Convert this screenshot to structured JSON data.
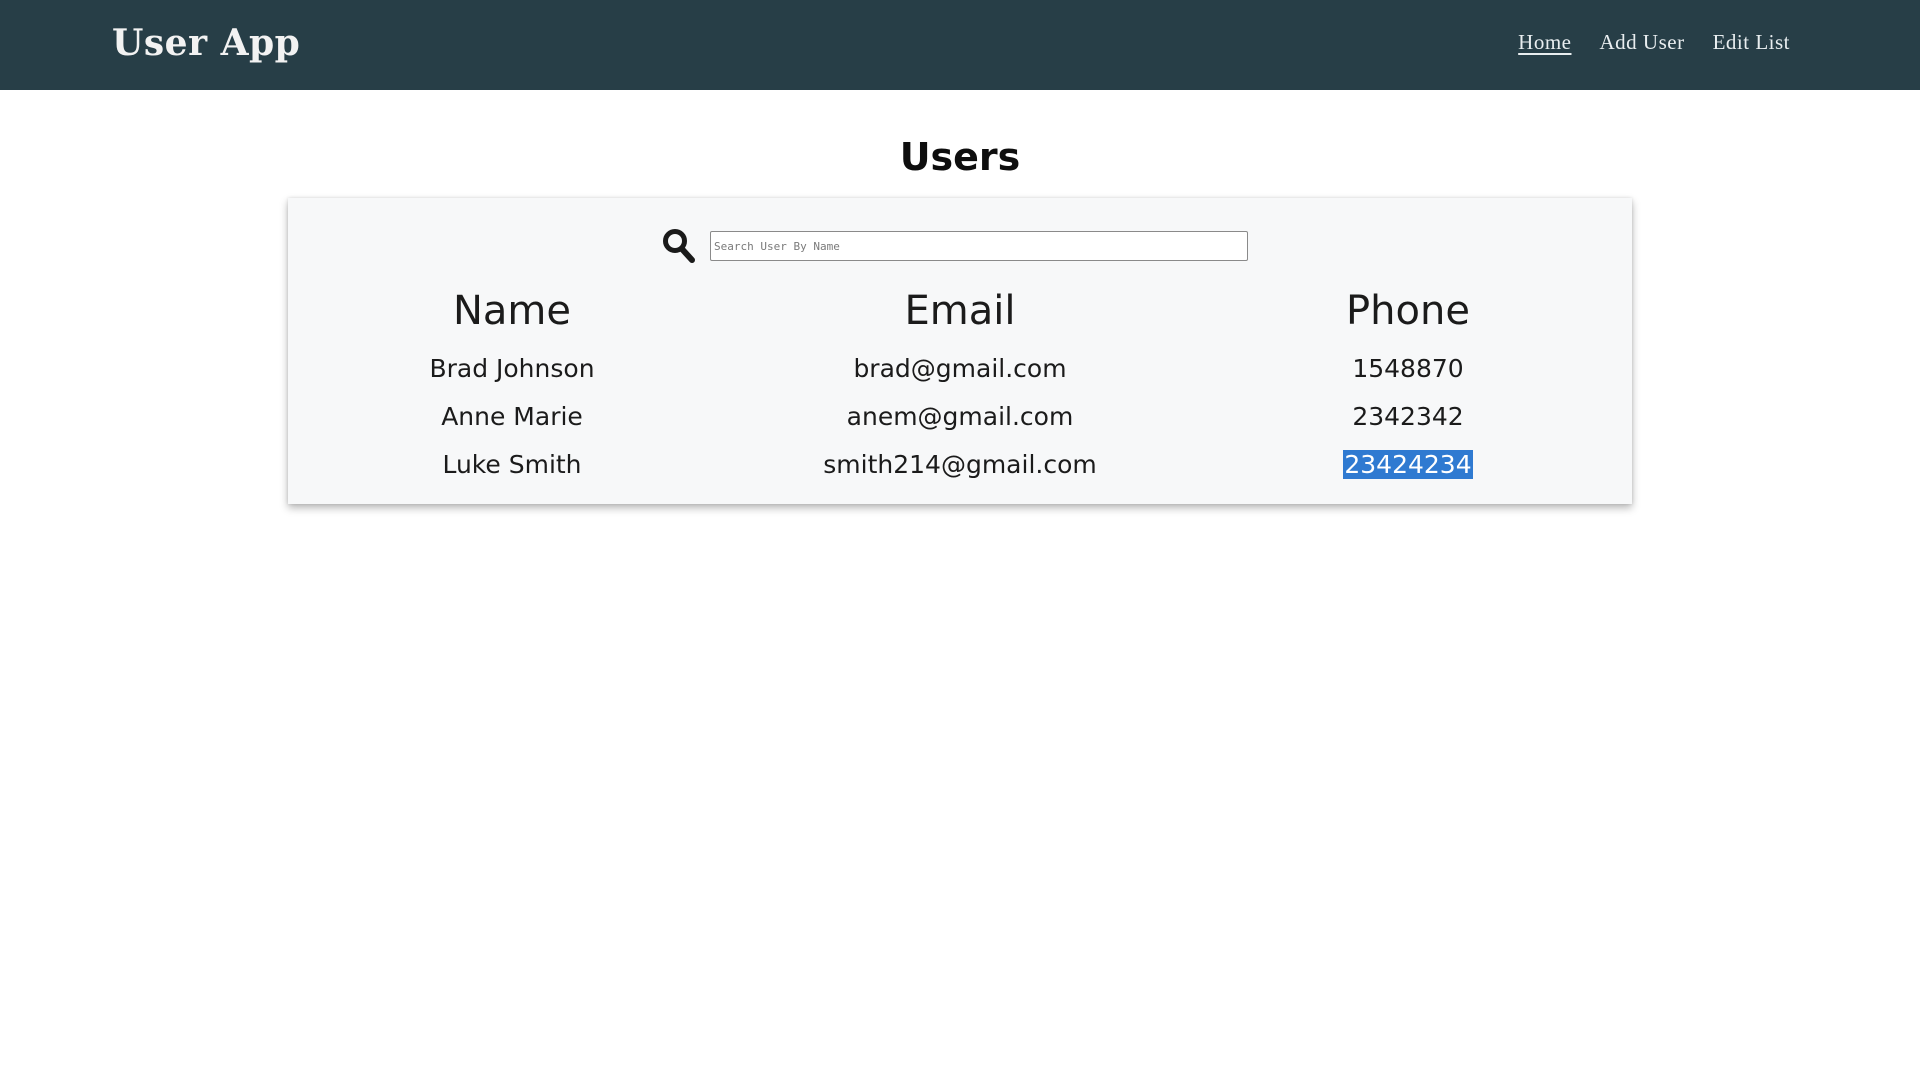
{
  "app": {
    "brand": "User App"
  },
  "nav": {
    "items": [
      {
        "label": "Home",
        "active": true
      },
      {
        "label": "Add User",
        "active": false
      },
      {
        "label": "Edit List",
        "active": false
      }
    ]
  },
  "page": {
    "title": "Users"
  },
  "search": {
    "icon": "search-icon",
    "placeholder": "Search User By Name",
    "value": ""
  },
  "table": {
    "headers": [
      "Name",
      "Email",
      "Phone"
    ],
    "rows": [
      {
        "name": "Brad Johnson",
        "email": "brad@gmail.com",
        "phone": "1548870"
      },
      {
        "name": "Anne Marie",
        "email": "anem@gmail.com",
        "phone": "2342342"
      },
      {
        "name": "Luke Smith",
        "email": "smith214@gmail.com",
        "phone": "23424234"
      }
    ],
    "selected_text": "23424234"
  },
  "colors": {
    "navbar": "#273e47",
    "card": "#f7f8f9",
    "selection": "#2f7ad1"
  }
}
